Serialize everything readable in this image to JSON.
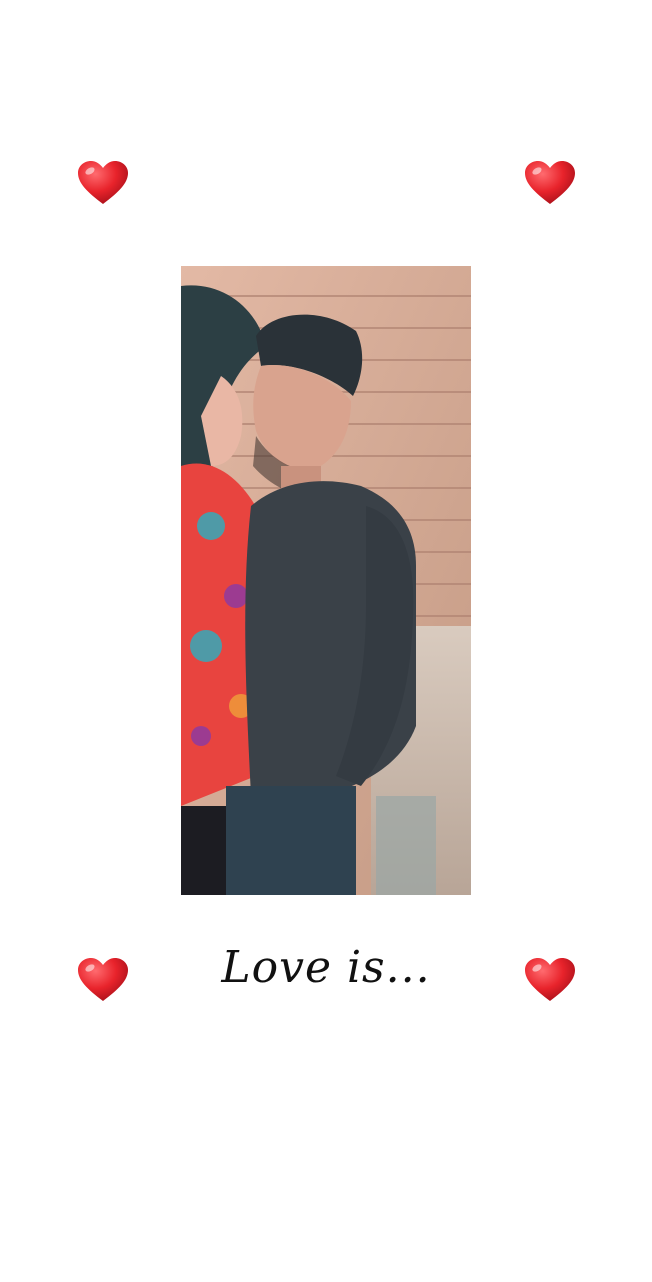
{
  "caption": "Love is...",
  "hearts": {
    "icon": "red-heart-icon",
    "color": "#e8232b"
  },
  "photo": {
    "icon": "couple-photo"
  }
}
